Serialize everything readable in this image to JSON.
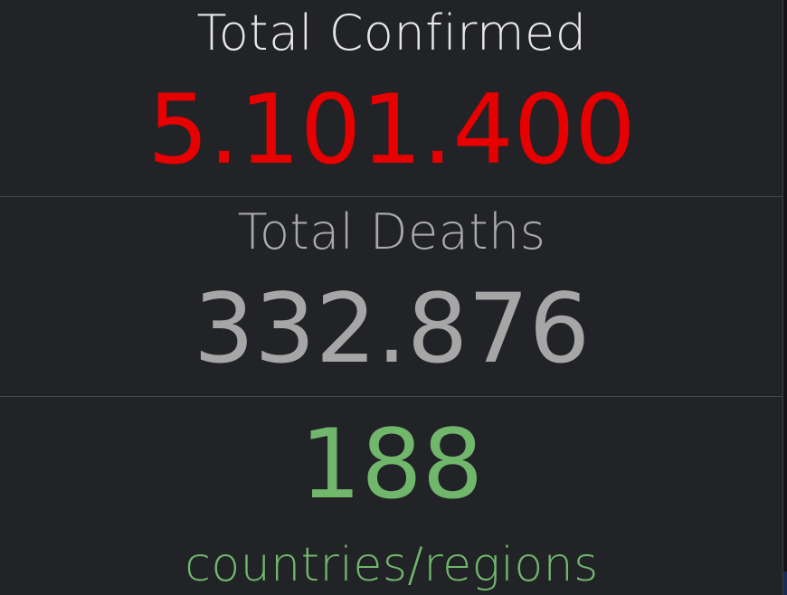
{
  "confirmed": {
    "label": "Total Confirmed",
    "value": "5.101.400",
    "color": "#e60000"
  },
  "deaths": {
    "label": "Total Deaths",
    "value": "332.876",
    "color": "#a6a6a6"
  },
  "countries": {
    "value": "188",
    "label": "countries/regions",
    "color": "#70b76c"
  },
  "theme": {
    "background": "#222327",
    "divider": "#45474c"
  }
}
